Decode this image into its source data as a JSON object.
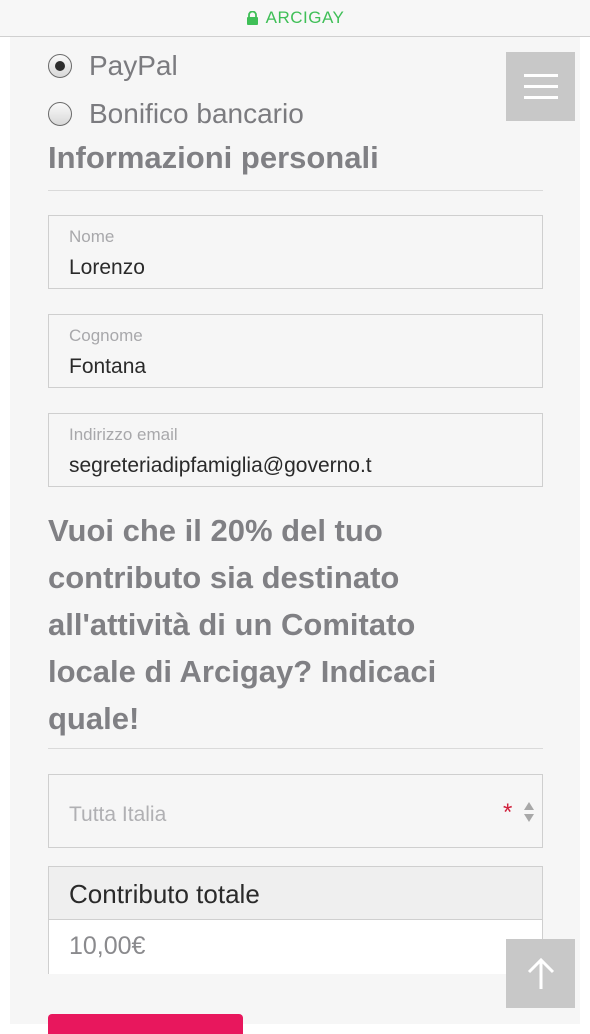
{
  "browser": {
    "domain": "ARCIGAY"
  },
  "payment": {
    "options": [
      {
        "label": "PayPal",
        "selected": true
      },
      {
        "label": "Bonifico bancario",
        "selected": false
      }
    ]
  },
  "personal": {
    "heading": "Informazioni personali",
    "fields": [
      {
        "label": "Nome",
        "value": "Lorenzo"
      },
      {
        "label": "Cognome",
        "value": "Fontana"
      },
      {
        "label": "Indirizzo email",
        "value": "segreteriadipfamiglia@governo.t"
      }
    ]
  },
  "committee": {
    "question_lines": [
      "Vuoi che il 20% del tuo",
      "contributo sia destinato",
      "all'attività di un Comitato",
      "locale di Arcigay? Indicaci",
      "quale!"
    ],
    "select_value": "Tutta Italia",
    "required_mark": "*"
  },
  "total": {
    "title": "Contributo totale",
    "value": "10,00€"
  },
  "colors": {
    "secure": "#3fbf57",
    "accent": "#e8175d",
    "required": "#d0203c"
  },
  "icons": {
    "lock": "lock-icon",
    "menu": "hamburger-menu-icon",
    "scroll_top": "arrow-up-icon",
    "select": "sort-arrows-icon"
  }
}
